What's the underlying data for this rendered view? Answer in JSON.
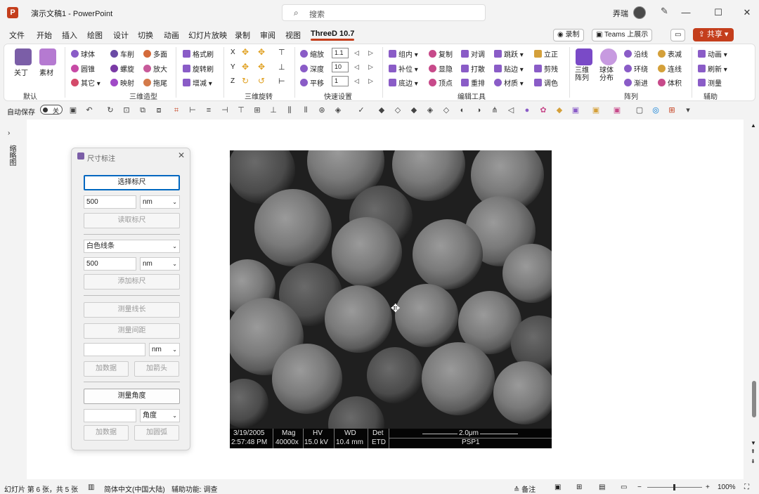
{
  "titlebar": {
    "logo": "P",
    "doc_title": "演示文稿1  -  PowerPoint",
    "search_placeholder": "搜索",
    "user_name": "弄瑞",
    "min": "—",
    "max": "☐",
    "close": "✕"
  },
  "tabs": [
    "文件",
    "开始",
    "插入",
    "绘图",
    "设计",
    "切换",
    "动画",
    "幻灯片放映",
    "录制",
    "审阅",
    "视图",
    "ThreeD 10.7"
  ],
  "top_buttons": {
    "record": "◉ 录制",
    "teams": "▣ Teams 上展示",
    "comment": "▭",
    "share": "⇪ 共享 ▾"
  },
  "ribbon": {
    "default_group": {
      "btn1": "关丁",
      "btn2": "素材",
      "label": "默认"
    },
    "group3d": {
      "col1": [
        "球体",
        "圆锥",
        "其它 ▾"
      ],
      "col2": [
        "车削",
        "螺旋",
        "映射"
      ],
      "col3": [
        "多面",
        "放大",
        "拖尾"
      ],
      "label": "三维造型"
    },
    "brush": {
      "items": [
        "格式刷",
        "旋转刷",
        "增减 ▾"
      ]
    },
    "rotate": {
      "labels": [
        "X",
        "Y",
        "Z"
      ],
      "label": "三维旋转"
    },
    "quick": {
      "items": [
        "缩放",
        "深度",
        "平移"
      ],
      "values": [
        "1.1",
        "10",
        "1"
      ],
      "label": "快速设置"
    },
    "edit": {
      "col1": [
        "组内 ▾",
        "补位 ▾",
        "底边 ▾"
      ],
      "col2": [
        "复制",
        "显隐",
        "顶点"
      ],
      "col3": [
        "对调",
        "打散",
        "重排"
      ],
      "col4": [
        "跳跃 ▾",
        "贴边 ▾",
        "材质 ▾"
      ],
      "col5": [
        "立正",
        "剪残",
        "调色"
      ],
      "label": "编辑工具"
    },
    "array": {
      "big1": "三维\n阵列",
      "big2": "球体\n分布",
      "col1": [
        "沿线",
        "环绕",
        "渐进"
      ],
      "col2": [
        "表减",
        "连线",
        "体积"
      ],
      "label": "阵列"
    },
    "assist": {
      "items": [
        "动画 ▾",
        "刷新 ▾",
        "测量"
      ],
      "label": "辅助"
    }
  },
  "qat": {
    "autosave": "自动保存",
    "toggle": "关"
  },
  "leftpane": {
    "label": "缩略图"
  },
  "dialog": {
    "title": "尺寸标注",
    "btn_select_scale": "选择标尺",
    "input1_value": "500",
    "unit1": "nm",
    "btn_read_scale": "读取标尺",
    "select_color": "白色线条",
    "input2_value": "500",
    "unit2": "nm",
    "btn_add_scale": "添加标尺",
    "btn_measure_length": "测量线长",
    "btn_measure_spacing": "测量间距",
    "input3_value": "",
    "unit3": "nm",
    "btn_add_data": "加数据",
    "btn_add_arrow": "加箭头",
    "btn_measure_angle": "测量角度",
    "input4_value": "",
    "unit4": "角度",
    "btn_add_data2": "加数据",
    "btn_add_arc": "加圆弧"
  },
  "sem": {
    "date": "3/19/2005",
    "time": "2:57:48 PM",
    "mag_label": "Mag",
    "mag": "40000x",
    "hv_label": "HV",
    "hv": "15.0 kV",
    "wd_label": "WD",
    "wd": "10.4 mm",
    "det_label": "Det",
    "det": "ETD",
    "scale": "2.0μm",
    "sample": "PSP1"
  },
  "statusbar": {
    "slide_info": "幻灯片 第 6 张，共 5 张",
    "language": "简体中文(中国大陆)",
    "accessibility": "辅助功能: 调查",
    "notes": "≙ 备注",
    "zoom": "100%"
  },
  "colors": {
    "accent": "#c43e1c",
    "dialog_primary_border": "#0067c0"
  }
}
